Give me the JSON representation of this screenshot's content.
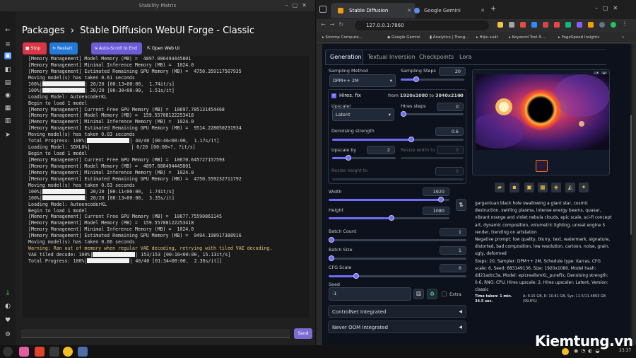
{
  "sm": {
    "title": "Stability Matrix",
    "breadcrumb_root": "Packages",
    "breadcrumb_sep": "›",
    "breadcrumb_page": "Stable Diffusion WebUI Forge - Classic",
    "btn_stop": "Stop",
    "btn_restart": "Restart",
    "btn_autoscroll": "Auto-Scroll to End",
    "btn_openweb": "Open Web UI",
    "send": "Send",
    "console": [
      "[Memory Management] Model Memory (MB) =  4897.086494445801",
      "[Memory Management] Minimal Inference Memory (MB) =  1024.0",
      "[Memory Management] Estimated Remaining GPU Memory (MB) =  4750.359117507935",
      "Moving model(s) has taken 0.61 seconds",
      "100%|#| 20/20 [00:13<00:00,  1.74it/s]",
      "100%|#| 20/20 [00:30<00:00,  1.51s/it]",
      "Loading Model: AutoencoderKL",
      "Begin to load 1 model",
      "[Memory Management] Current Free GPU Memory (MB) =  10697.785131454468",
      "[Memory Management] Model Memory (MB) =  159.55708122253418",
      "[Memory Management] Minimal Inference Memory (MB) =  1024.0",
      "[Memory Management] Estimated Remaining GPU Memory (MB) =  9514.228050231934",
      "Moving model(s) has taken 0.03 seconds",
      "Total Progress: 100%|#| 40/40 [00:46<00:00,  1.17s/it]",
      "Loading Model: SDXL0%|#| 0/20 [00:00<?, ?it/s]",
      "Begin to load 1 model",
      "[Memory Management] Current Free GPU Memory (MB) =  10670.645727157593",
      "[Memory Management] Model Memory (MB) =  4897.086494445801",
      "[Memory Management] Minimal Inference Memory (MB) =  1024.0",
      "[Memory Management] Estimated Remaining GPU Memory (MB) =  4750.559232711792",
      "Moving model(s) has taken 0.63 seconds",
      "100%|#| 20/20 [00:11<00:00,  1.74it/s]",
      "100%|#| 20/20 [00:13<00:00,  3.35s/it]",
      "Loading Model: AutoencoderKL",
      "Begin to load 1 model",
      "[Memory Management] Current Free GPU Memory (MB) =  10677.75590861145",
      "[Memory Management] Model Memory (MB) =  159.55708122253418",
      "[Memory Management] Minimal Inference Memory (MB) =  1024.0",
      "[Memory Management] Estimated Remaining GPU Memory (MB) =  9494.198917388916",
      "Moving model(s) has taken 0.66 seconds",
      "Warning: Ran out of memory when regular VAE decoding, retrying with tiled VAE decoding.",
      "VAE tiled decode: 100%|#| 153/153 [00:10<00:00, 15.13it/s]",
      "Total Progress: 100%|#| 40/40 [01:34<00:00,  2.36s/it]]"
    ]
  },
  "browser": {
    "tab1": "Stable Diffusion",
    "tab2": "Google Gemini",
    "url": "127.0.0.1:7860",
    "bookmarks": [
      "Sicomp Compute...",
      "Google Gemini",
      "Analytics | Trang...",
      "Hiệu suất",
      "Keyword Tool Â...",
      "PageSpeed Insights"
    ]
  },
  "webui": {
    "tabs": [
      "Generation",
      "Textual Inversion",
      "Checkpoints",
      "Lora"
    ],
    "sampling_method_label": "Sampling Method",
    "sampling_method": "DPM++ 2M",
    "sampling_steps_label": "Sampling Steps",
    "sampling_steps": "20",
    "hires_label": "Hires. fix",
    "hires_res_from": "from",
    "hires_res_a": "1920x1080",
    "hires_res_to": "to",
    "hires_res_b": "3840x2160",
    "upscaler_label": "Upscaler",
    "upscaler": "Latent",
    "hires_steps_label": "Hires steps",
    "hires_steps": "0",
    "denoise_label": "Denoising strength",
    "denoise": "0.6",
    "upscale_by_label": "Upscale by",
    "upscale_by": "2",
    "resize_w_label": "Resize width to",
    "resize_w": "0",
    "resize_h_label": "Resize height to",
    "resize_h": "0",
    "width_label": "Width",
    "width": "1920",
    "height_label": "Height",
    "height": "1080",
    "batch_count_label": "Batch Count",
    "batch_count": "1",
    "batch_size_label": "Batch Size",
    "batch_size": "1",
    "cfg_label": "CFG Scale",
    "cfg": "6",
    "seed_label": "Seed",
    "seed": "-1",
    "extra_label": "Extra",
    "controlnet": "ControlNet Integrated",
    "oom": "Never OOM Integrated",
    "info": "gargantuan black hole swallowing a giant star, cosmic destruction, swirling plasma, intense energy beams, quasar, vibrant orange and violet nebula clouds, epic scale, sci-fi concept art, dynamic composition, volumetric lighting, unreal engine 5 render, trending on artstation",
    "neg": "Negative prompt: low quality, blurry, text, watermark, signature, distorted, bad composition, low resolution, cartoon, noise, grain, ugly, deformed",
    "params": "Steps: 20, Sampler: DPM++ 2M, Schedule type: Karras, CFG scale: 6, Seed: 683149136, Size: 1920x1080, Model hash: dd21adcc3a, Model: epicrealismXL_pureFix, Denoising strength: 0.6, RNG: CPU, Hires upscale: 2, Hires upscaler: Latent, Version: classic",
    "time_taken": "Time taken: 1 min. 34.5 sec.",
    "vram": "A: 9.15 GB, R: 10.81 GB, Sys: 11.5/11.4893 GB (99.8%)"
  },
  "watermark": "Kiemtung.vn",
  "clock": "23:37",
  "progress": {
    "sampling_steps": 0.24,
    "hires_steps": 0.0,
    "denoise": 0.6,
    "upscale_by": 0.25,
    "width": 0.93,
    "height": 0.52,
    "batch_count": 0.0,
    "batch_size": 0.0,
    "cfg": 0.2
  }
}
